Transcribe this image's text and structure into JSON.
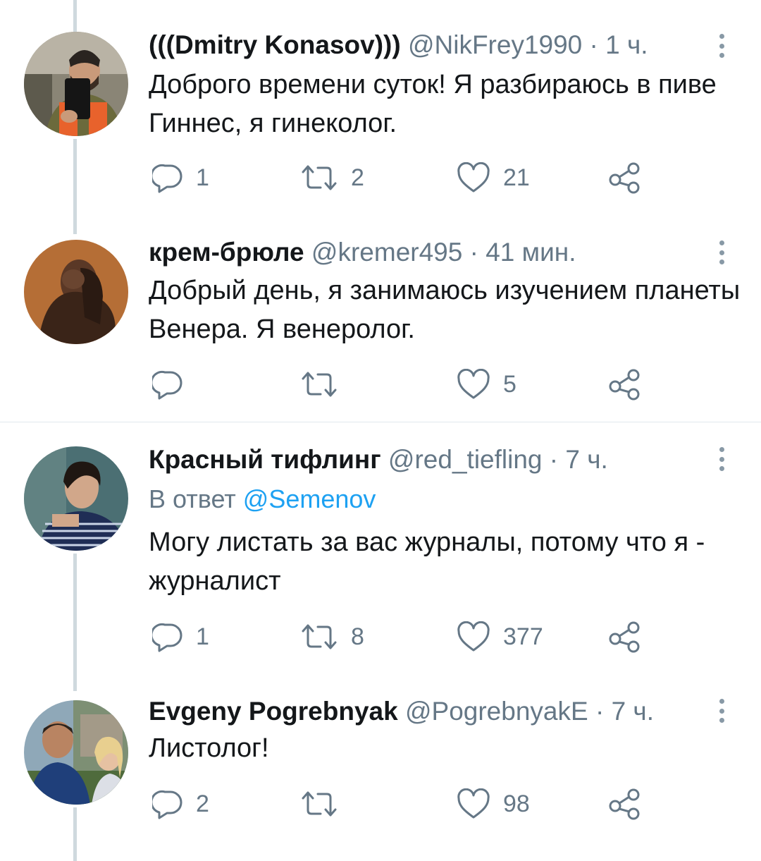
{
  "tweets": [
    {
      "name": "(((Dmitry Konasov)))",
      "handle": "@NikFrey1990",
      "separator": "·",
      "time": "1 ч.",
      "reply_prefix": "",
      "reply_mention": "",
      "text": "Доброго времени суток! Я разбираюсь в пиве Гиннес, я гинеколог.",
      "replies": "1",
      "retweets": "2",
      "likes": "21"
    },
    {
      "name": "крем-брюле",
      "handle": "@kremer495",
      "separator": "·",
      "time": "41 мин.",
      "reply_prefix": "",
      "reply_mention": "",
      "text": "Добрый день, я занимаюсь изучением планеты Венера. Я венеролог.",
      "replies": "",
      "retweets": "",
      "likes": "5"
    },
    {
      "name": "Красный тифлинг",
      "handle": "@red_tiefling",
      "separator": "·",
      "time": "7 ч.",
      "reply_prefix": "В ответ",
      "reply_mention": "@Semenov",
      "text": "Могу листать за вас журналы, потому что я - журналист",
      "replies": "1",
      "retweets": "8",
      "likes": "377"
    },
    {
      "name": "Evgeny Pogrebnyak",
      "handle": "@PogrebnyakE",
      "separator": "·",
      "time": "7 ч.",
      "reply_prefix": "",
      "reply_mention": "",
      "text": "Листолог!",
      "replies": "2",
      "retweets": "",
      "likes": "98"
    }
  ],
  "icons": {
    "reply": "reply-icon",
    "retweet": "retweet-icon",
    "like": "heart-icon",
    "share": "share-icon",
    "more": "more-vertical-icon"
  },
  "colors": {
    "text": "#14171a",
    "secondary": "#657786",
    "link": "#1da1f2",
    "thread_line": "#cfd9de",
    "icon": "#657786"
  }
}
